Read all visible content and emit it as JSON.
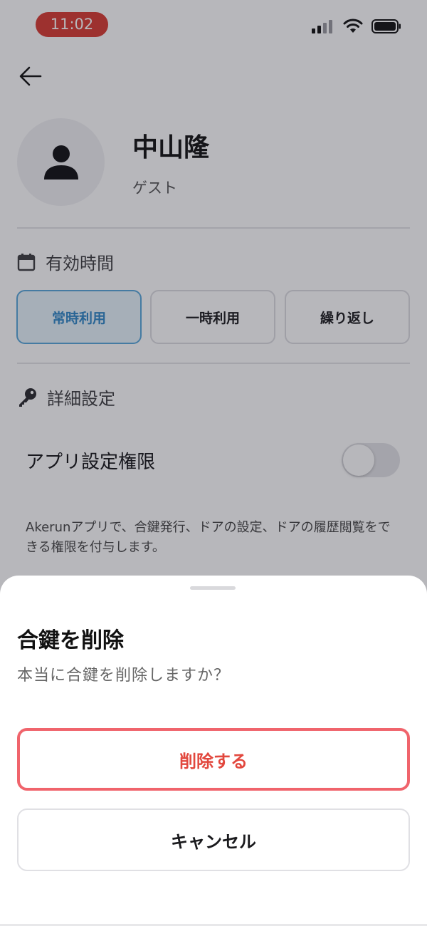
{
  "status_bar": {
    "time": "11:02"
  },
  "profile": {
    "name": "中山隆",
    "role": "ゲスト"
  },
  "validity": {
    "heading": "有効時間",
    "options": [
      {
        "label": "常時利用",
        "selected": true
      },
      {
        "label": "一時利用",
        "selected": false
      },
      {
        "label": "繰り返し",
        "selected": false
      }
    ]
  },
  "details": {
    "heading": "詳細設定",
    "app_permission_label": "アプリ設定権限",
    "app_permission_enabled": false,
    "description": "Akerunアプリで、合鍵発行、ドアの設定、ドアの履歴閲覧をできる権限を付与します。"
  },
  "sheet": {
    "title": "合鍵を削除",
    "message": "本当に合鍵を削除しますか？",
    "delete_label": "削除する",
    "cancel_label": "キャンセル"
  },
  "colors": {
    "status_pill": "#d93a31",
    "selected_segment": "#2f86c7",
    "delete": "#e2473d"
  }
}
